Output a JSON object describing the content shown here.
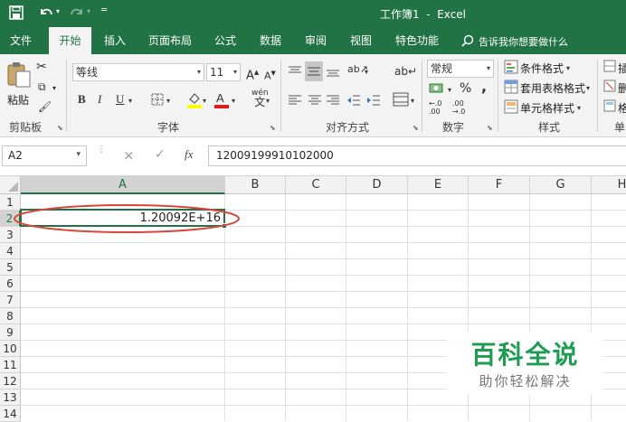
{
  "title": {
    "text": "工作簿1  -  Excel"
  },
  "qat": {
    "save_icon": "save-icon",
    "undo_icon": "undo-icon",
    "redo_icon": "redo-icon",
    "customize_icon": "customize-qat-icon"
  },
  "tabs": [
    {
      "label": "文件"
    },
    {
      "label": "开始"
    },
    {
      "label": "插入"
    },
    {
      "label": "页面布局"
    },
    {
      "label": "公式"
    },
    {
      "label": "数据"
    },
    {
      "label": "审阅"
    },
    {
      "label": "视图"
    },
    {
      "label": "特色功能"
    }
  ],
  "tell_me": {
    "placeholder": "告诉我你想要做什么"
  },
  "ribbon": {
    "clipboard": {
      "paste_label": "粘贴",
      "group_label": "剪贴板"
    },
    "font": {
      "font_name": "等线",
      "font_size": "11",
      "grow": "A",
      "shrink": "A",
      "bold": "B",
      "italic": "I",
      "underline": "U",
      "wen": "wén",
      "wen_char": "文",
      "group_label": "字体"
    },
    "alignment": {
      "group_label": "对齐方式",
      "orient_label": "ab"
    },
    "number": {
      "format": "常规",
      "percent": "%",
      "comma": ",",
      "inc_dec": "←.0\n.00",
      "dec_dec": ".00\n→.0",
      "group_label": "数字"
    },
    "styles": {
      "conditional": "条件格式",
      "table": "套用表格格式",
      "cell_styles": "单元格样式",
      "group_label": "样式"
    },
    "cells": {
      "insert_short": "插",
      "delete_short": "删",
      "format_short": "格",
      "group_label": "单"
    }
  },
  "formula_bar": {
    "name_box": "A2",
    "cancel": "×",
    "enter": "✓",
    "fx": "fx",
    "content": "12009199910102000"
  },
  "columns": [
    "A",
    "B",
    "C",
    "D",
    "E",
    "F",
    "G",
    "H"
  ],
  "rows": [
    "1",
    "2",
    "3",
    "4",
    "5",
    "6",
    "7",
    "8",
    "9",
    "10",
    "11",
    "12",
    "13",
    "14"
  ],
  "cells": {
    "A2": "1.20092E+16"
  },
  "selected_cell": "A2",
  "annotation_color": "#d9463a",
  "accent_color": "#217346",
  "watermark": {
    "title": "百科全说",
    "subtitle": "助你轻松解决",
    "title_color": "#1e9d52"
  }
}
